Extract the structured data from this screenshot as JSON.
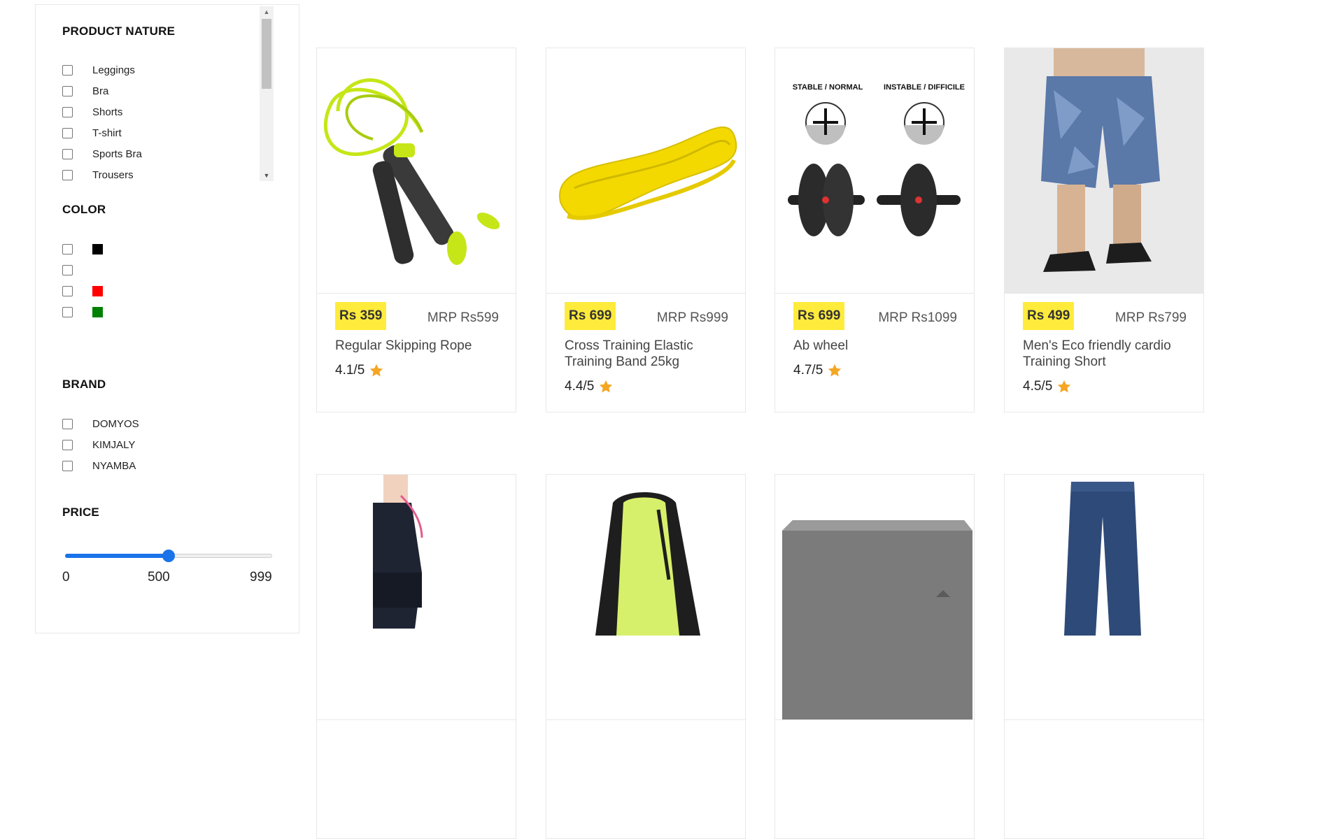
{
  "filters": {
    "product_nature": {
      "title": "PRODUCT NATURE",
      "items": [
        "Leggings",
        "Bra",
        "Shorts",
        "T-shirt",
        "Sports Bra",
        "Trousers"
      ]
    },
    "color": {
      "title": "COLOR",
      "swatches": [
        "#000000",
        "",
        "#ff0000",
        "#008000"
      ]
    },
    "brand": {
      "title": "BRAND",
      "items": [
        "DOMYOS",
        "KIMJALY",
        "NYAMBA"
      ]
    },
    "price": {
      "title": "PRICE",
      "min_label": "0",
      "current_label": "500",
      "max_label": "999",
      "min": 0,
      "max": 999,
      "value": 500
    }
  },
  "colors": {
    "badge": "#ffeb3b",
    "accent": "#1a73e8",
    "star": "#f5a623"
  },
  "products": [
    {
      "price": "Rs 359",
      "mrp": "MRP Rs599",
      "name": "Regular Skipping Rope",
      "rating": "4.1/5",
      "image_icon": "skipping-rope-image"
    },
    {
      "price": "Rs 699",
      "mrp": "MRP Rs999",
      "name": "Cross Training Elastic Training Band 25kg",
      "rating": "4.4/5",
      "image_icon": "resistance-band-image"
    },
    {
      "price": "Rs 699",
      "mrp": "MRP Rs1099",
      "name": "Ab wheel",
      "rating": "4.7/5",
      "image_icon": "ab-wheel-image",
      "image_text": {
        "left": "STABLE / NORMAL",
        "right": "INSTABLE / DIFFICILE"
      }
    },
    {
      "price": "Rs 499",
      "mrp": "MRP Rs799",
      "name": "Men's Eco friendly cardio Training Short",
      "rating": "4.5/5",
      "image_icon": "shorts-image"
    }
  ],
  "products_row2": [
    {
      "image_icon": "woman-belt-image"
    },
    {
      "image_icon": "drawstring-bag-image"
    },
    {
      "image_icon": "yoga-block-image"
    },
    {
      "image_icon": "trousers-image"
    }
  ]
}
